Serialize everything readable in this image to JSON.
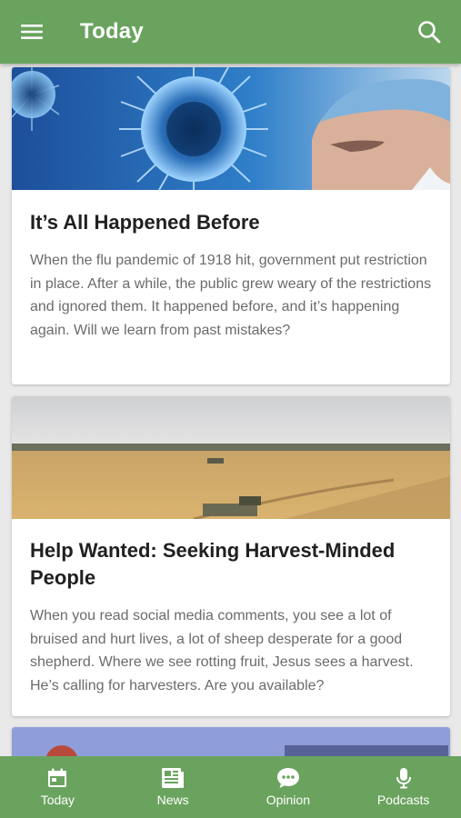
{
  "app": {
    "title": "Today"
  },
  "articles": [
    {
      "title": "It’s All Happened Before",
      "summary": "When the flu pandemic of 1918 hit, government put restriction in place. After a while, the public grew weary of the restrictions and ignored them. It happened before, and it’s happening again. Will we learn from past mistakes?"
    },
    {
      "title": "Help Wanted: Seeking Harvest-Minded People",
      "summary": "When you read social media comments, you see a lot of bruised and hurt lives, a lot of sheep desperate for a good shepherd. Where we see rotting fruit, Jesus sees a harvest. He’s calling for harvesters. Are you available?"
    }
  ],
  "nav": {
    "items": [
      {
        "label": "Today",
        "icon": "calendar-icon"
      },
      {
        "label": "News",
        "icon": "newspaper-icon"
      },
      {
        "label": "Opinion",
        "icon": "chat-bubble-icon"
      },
      {
        "label": "Podcasts",
        "icon": "microphone-icon"
      }
    ]
  },
  "colors": {
    "brand": "#6aa35e"
  }
}
